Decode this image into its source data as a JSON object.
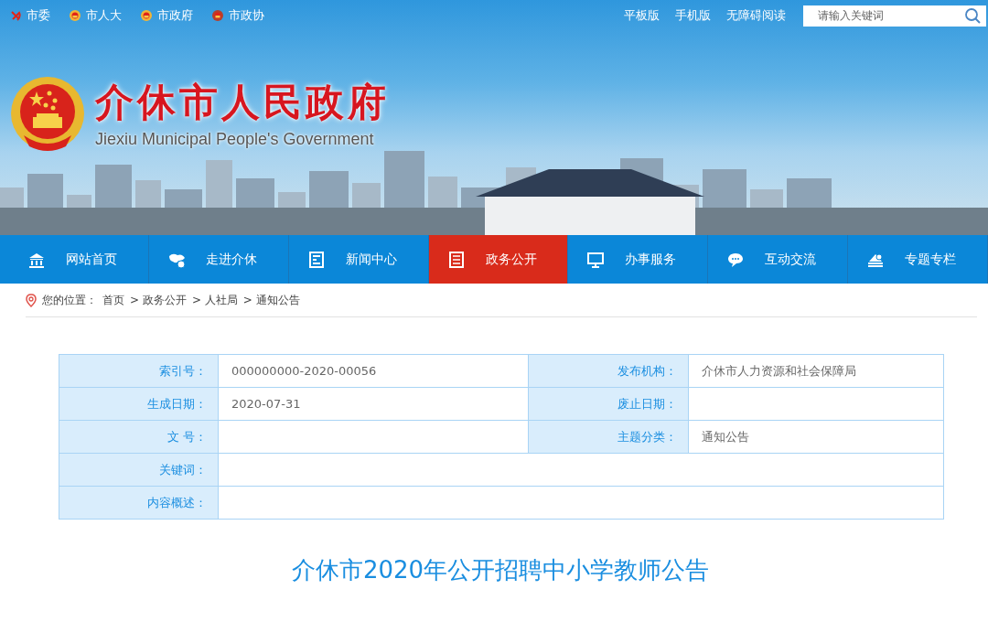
{
  "top_links": [
    {
      "label": "市委"
    },
    {
      "label": "市人大"
    },
    {
      "label": "市政府"
    },
    {
      "label": "市政协"
    }
  ],
  "top_right_links": [
    {
      "label": "平板版"
    },
    {
      "label": "手机版"
    },
    {
      "label": "无障碍阅读"
    }
  ],
  "search": {
    "placeholder": "请输入关键词"
  },
  "logo": {
    "title": "介休市人民政府",
    "subtitle": "Jiexiu Municipal People's Government"
  },
  "nav": [
    {
      "label": "网站首页",
      "selected": false
    },
    {
      "label": "走进介休",
      "selected": false
    },
    {
      "label": "新闻中心",
      "selected": false
    },
    {
      "label": "政务公开",
      "selected": true
    },
    {
      "label": "办事服务",
      "selected": false
    },
    {
      "label": "互动交流",
      "selected": false
    },
    {
      "label": "专题专栏",
      "selected": false
    }
  ],
  "breadcrumb": {
    "prefix": "您的位置：",
    "items": [
      "首页",
      "> 政务公开",
      "> 人社局",
      "> 通知公告"
    ]
  },
  "info_table": {
    "rows": [
      {
        "fields": [
          {
            "label": "索引号：",
            "value": "000000000-2020-00056"
          },
          {
            "label": "发布机构：",
            "value": "介休市人力资源和社会保障局"
          }
        ]
      },
      {
        "fields": [
          {
            "label": "生成日期：",
            "value": "2020-07-31"
          },
          {
            "label": "废止日期："
          }
        ]
      },
      {
        "fields": [
          {
            "label": "文 号："
          },
          {
            "label": "主题分类：",
            "value": "通知公告"
          }
        ]
      },
      {
        "fields": [
          {
            "label": "关键词："
          }
        ]
      },
      {
        "fields": [
          {
            "label": "内容概述："
          }
        ]
      }
    ]
  },
  "article": {
    "title": "介休市2020年公开招聘中小学教师公告"
  }
}
